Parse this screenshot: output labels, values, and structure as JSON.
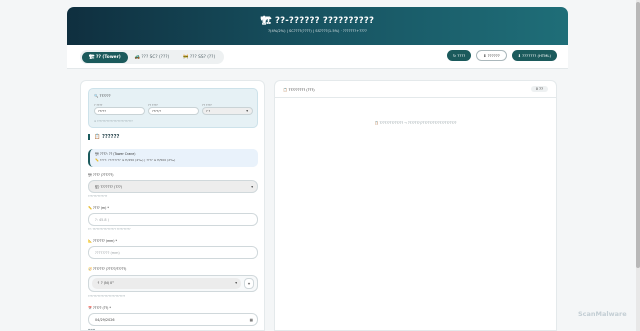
{
  "header": {
    "title": "🏗 ??-?????? ??????????",
    "subtitle": "?(4%/2%) | SC????(????) | SS????(1.5%) · ???????+????"
  },
  "tabs": [
    {
      "label": "🏗 ?? (Tower)"
    },
    {
      "label": "🚜 ??? SC? (???)"
    },
    {
      "label": "🚧 ??? SS? (??)"
    }
  ],
  "actions": [
    {
      "label": "↻ ????"
    },
    {
      "label": "⬇ ??????"
    },
    {
      "label": "⬇ ??????? (HTML)"
    }
  ],
  "filter": {
    "title": "🔍 ??????",
    "label_1": "? ????",
    "value_1": "?????",
    "label_2": "?? ????",
    "value_2": "????/?",
    "label_3": "?? ????",
    "select_3": "? ?",
    "note": "※ ??????????????????????????"
  },
  "form": {
    "section_title": "📋 ??????",
    "equipment_line1": "🏗 ????: ?? (Tower Crane)",
    "equipment_line2": "📏 ????: ???????? ≤ H/250 (4‰) | ???? ≤ H/500 (2‰)",
    "type_label": "🏗 ???? (??????)",
    "type_value": "🏗 ??????? (???)",
    "type_hint": "??????????????",
    "height_label": "📏 ???? (m) *",
    "height_placeholder": "?: 45.8 )",
    "height_hint": "??: ????????????????? ??????????",
    "dev_label": "📐 ??????? (mm) *",
    "dev_placeholder": "???????? (mm)",
    "dir_label": "🧭 ??????? (?????/?????)",
    "dir_value": "↑ ? (N) 0°",
    "dir_hint": "???????????????????????????",
    "date_label": "📅 ????? (??) *",
    "date_value": "04/29/2026"
  },
  "records": {
    "title": "📋 ????????? (???)",
    "count": "0 ??",
    "empty": "📋 ?????????????? → ???????(?????????????????????"
  },
  "watermark": "ScanMalware"
}
